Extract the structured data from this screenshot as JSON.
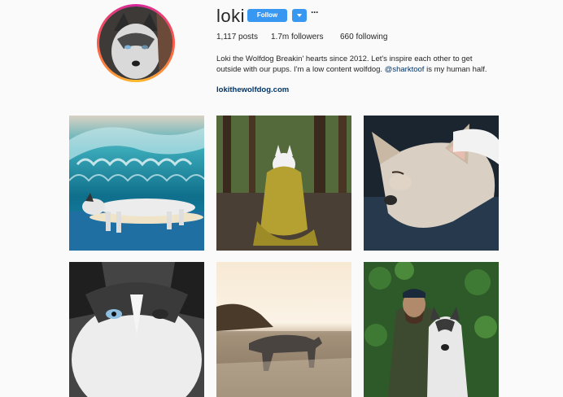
{
  "profile": {
    "username": "loki",
    "follow_label": "Follow",
    "more_label": "···",
    "stats": {
      "posts": "1,117 posts",
      "followers": "1.7m followers",
      "following": "660 following"
    },
    "bio_main": "Loki the Wolfdog Breakin' hearts since 2012. Let's inspire each other to get outside with our pups. I'm a low content wolfdog. ",
    "bio_mention": "@sharktoof",
    "bio_end": " is my human half.",
    "website": "lokithewolfdog.com"
  },
  "colors": {
    "accent": "#3897f0",
    "link": "#003569",
    "background": "#fafafa"
  },
  "posts": [
    {
      "subject": "dog lying on surfboard under a wave"
    },
    {
      "subject": "dog sitting in a sleeping bag in a forest"
    },
    {
      "subject": "close-up of dog resting its head"
    },
    {
      "subject": "close-up of husky face with blue eye"
    },
    {
      "subject": "wolfdog walking on a beach at sunset"
    },
    {
      "subject": "bearded man hugging dog in front of foliage"
    }
  ]
}
